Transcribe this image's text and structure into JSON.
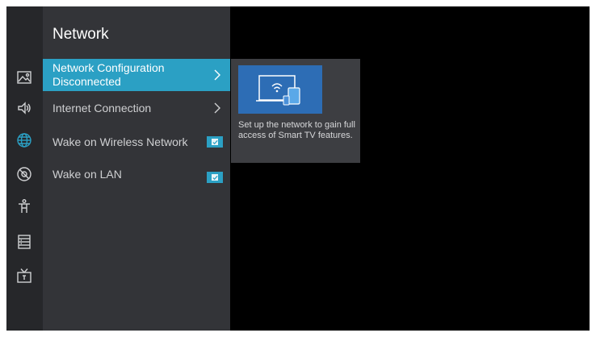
{
  "panel": {
    "title": "Network"
  },
  "sidebar_icons": [
    {
      "name": "picture-icon",
      "selected": false
    },
    {
      "name": "sound-icon",
      "selected": false
    },
    {
      "name": "network-globe-icon",
      "selected": true
    },
    {
      "name": "compass-icon",
      "selected": false
    },
    {
      "name": "accessibility-icon",
      "selected": false
    },
    {
      "name": "system-list-icon",
      "selected": false
    },
    {
      "name": "tv-icon",
      "selected": false
    }
  ],
  "menu": {
    "items": [
      {
        "label": "Network Configuration",
        "sub": "Disconnected",
        "control": "chevron",
        "selected": true
      },
      {
        "label": "Internet Connection",
        "control": "chevron",
        "selected": false
      },
      {
        "label": "Wake on Wireless Network",
        "control": "checkbox",
        "checked": true,
        "selected": false
      },
      {
        "label": "Wake on LAN",
        "control": "checkbox",
        "checked": true,
        "selected": false
      }
    ]
  },
  "info": {
    "text": "Set up the network to gain full access of Smart TV features.",
    "image_icon": "tv-phone-wifi-illustration-icon"
  },
  "colors": {
    "accent": "#2ba0c4",
    "panel_bg": "#333438",
    "iconbar_bg": "#26272a",
    "screen_bg": "#000000",
    "card_bg": "#3d3e42",
    "illustration_bg": "#2d6db5"
  }
}
